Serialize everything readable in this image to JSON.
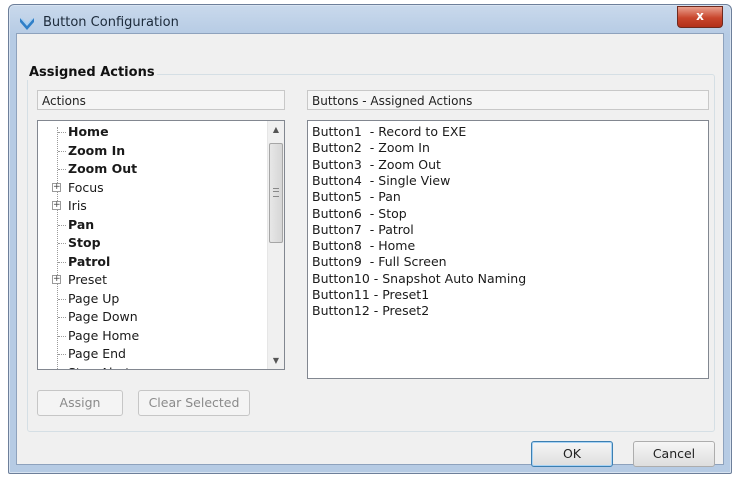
{
  "window": {
    "title": "Button Configuration",
    "close_symbol": "x",
    "icon": "app-chevron-icon"
  },
  "group": {
    "title": "Assigned Actions"
  },
  "actions_panel": {
    "header": "Actions",
    "items": [
      {
        "label": "Home",
        "bold": true,
        "expandable": false
      },
      {
        "label": "Zoom In",
        "bold": true,
        "expandable": false
      },
      {
        "label": "Zoom Out",
        "bold": true,
        "expandable": false
      },
      {
        "label": "Focus",
        "bold": false,
        "expandable": true
      },
      {
        "label": "Iris",
        "bold": false,
        "expandable": true
      },
      {
        "label": "Pan",
        "bold": true,
        "expandable": false
      },
      {
        "label": "Stop",
        "bold": true,
        "expandable": false
      },
      {
        "label": "Patrol",
        "bold": true,
        "expandable": false
      },
      {
        "label": "Preset",
        "bold": false,
        "expandable": true
      },
      {
        "label": "Page Up",
        "bold": false,
        "expandable": false
      },
      {
        "label": "Page Down",
        "bold": false,
        "expandable": false
      },
      {
        "label": "Page Home",
        "bold": false,
        "expandable": false
      },
      {
        "label": "Page End",
        "bold": false,
        "expandable": false
      },
      {
        "label": "Stop Alert",
        "bold": false,
        "expandable": false
      }
    ]
  },
  "assigned_panel": {
    "header": "Buttons - Assigned Actions",
    "lines": [
      "Button1  - Record to EXE",
      "Button2  - Zoom In",
      "Button3  - Zoom Out",
      "Button4  - Single View",
      "Button5  - Pan",
      "Button6  - Stop",
      "Button7  - Patrol",
      "Button8  - Home",
      "Button9  - Full Screen",
      "Button10 - Snapshot Auto Naming",
      "Button11 - Preset1",
      "Button12 - Preset2"
    ]
  },
  "buttons": {
    "assign": "Assign",
    "clear_selected": "Clear Selected",
    "ok": "OK",
    "cancel": "Cancel"
  },
  "colors": {
    "title_bar": "#b6cbe4",
    "close_button": "#c8452c",
    "dialog_bg": "#f0f0f0"
  }
}
